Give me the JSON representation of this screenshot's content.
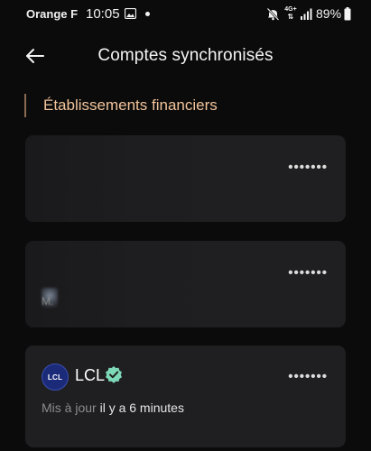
{
  "status_bar": {
    "carrier": "Orange F",
    "time": "10:05",
    "network": "4G+",
    "battery": "89%"
  },
  "header": {
    "title": "Comptes synchronisés"
  },
  "section": {
    "title": "Établissements financiers",
    "accent_color": "#8a6b52",
    "title_color": "#f2c49c"
  },
  "accounts": [
    {
      "name": "",
      "masked_number": "•••••••"
    },
    {
      "name": "M.",
      "masked_number": "•••••••"
    },
    {
      "name": "LCL",
      "logo_text": "LCL",
      "verified": true,
      "masked_number": "•••••••",
      "update_label": "Mis à jour",
      "update_value": "il y a 6 minutes"
    }
  ],
  "colors": {
    "background": "#0b0b0b",
    "card": "#1f1f21",
    "verified": "#7dd9b8",
    "lcl_brand": "#1b2b7a"
  }
}
